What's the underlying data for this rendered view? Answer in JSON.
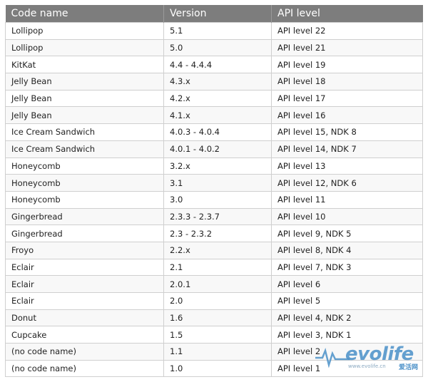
{
  "columns": [
    "Code name",
    "Version",
    "API level"
  ],
  "rows": [
    [
      "Lollipop",
      "5.1",
      "API level 22"
    ],
    [
      "Lollipop",
      "5.0",
      "API level 21"
    ],
    [
      "KitKat",
      "4.4 - 4.4.4",
      "API level 19"
    ],
    [
      "Jelly Bean",
      "4.3.x",
      "API level 18"
    ],
    [
      "Jelly Bean",
      "4.2.x",
      "API level 17"
    ],
    [
      "Jelly Bean",
      "4.1.x",
      "API level 16"
    ],
    [
      "Ice Cream Sandwich",
      "4.0.3 - 4.0.4",
      "API level 15, NDK 8"
    ],
    [
      "Ice Cream Sandwich",
      "4.0.1 - 4.0.2",
      "API level 14, NDK 7"
    ],
    [
      "Honeycomb",
      "3.2.x",
      "API level 13"
    ],
    [
      "Honeycomb",
      "3.1",
      "API level 12, NDK 6"
    ],
    [
      "Honeycomb",
      "3.0",
      "API level 11"
    ],
    [
      "Gingerbread",
      "2.3.3 - 2.3.7",
      "API level 10"
    ],
    [
      "Gingerbread",
      "2.3 - 2.3.2",
      "API level 9, NDK 5"
    ],
    [
      "Froyo",
      "2.2.x",
      "API level 8, NDK 4"
    ],
    [
      "Eclair",
      "2.1",
      "API level 7, NDK 3"
    ],
    [
      "Eclair",
      "2.0.1",
      "API level 6"
    ],
    [
      "Eclair",
      "2.0",
      "API level 5"
    ],
    [
      "Donut",
      "1.6",
      "API level 4, NDK 2"
    ],
    [
      "Cupcake",
      "1.5",
      "API level 3, NDK 1"
    ],
    [
      "(no code name)",
      "1.1",
      "API level 2"
    ],
    [
      "(no code name)",
      "1.0",
      "API level 1"
    ]
  ],
  "watermark": {
    "brand": "evolife",
    "sub": "www.evolife.cn",
    "cn": "爱活网",
    "color": "#4a90c8"
  },
  "colors": {
    "header_bg": "#7d7d7d",
    "header_text": "#ffffff",
    "border": "#cfcfcf"
  }
}
